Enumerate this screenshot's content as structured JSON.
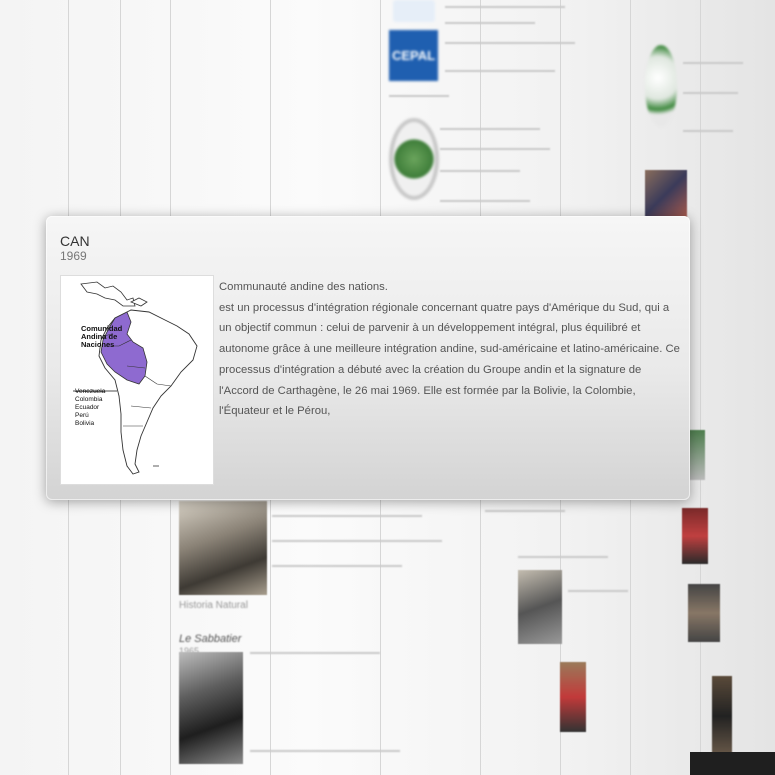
{
  "card": {
    "title": "CAN",
    "year": "1969",
    "lead": "Communauté andine des nations.",
    "description": "est un processus d'intégration régionale concernant quatre pays d'Amérique du Sud, qui a un objectif commun : celui de parvenir à un développement intégral, plus équilibré et autonome grâce à une meilleure intégration andine, sud-américaine et latino-américaine. Ce processus d'intégration a débuté avec la création du Groupe andin et la signature de l'Accord de Carthagène, le 26 mai 1969. Elle est formée par la Bolivie, la Colombie, l'Équateur et le Pérou,",
    "map": {
      "label_line1": "Comunidad",
      "label_line2": "Andina de",
      "label_line3": "Naciones",
      "legend": [
        "Venezuela",
        "Colombia",
        "Ecuador",
        "Perú",
        "Bolivia"
      ],
      "highlight_color": "#8e6ad0"
    }
  },
  "background": {
    "logo_text": "CEPAL",
    "brand_color": "#1f5fb0",
    "caption_left": "Historia Natural",
    "entry_title": "Le Sabbatier",
    "entry_year": "1965"
  }
}
